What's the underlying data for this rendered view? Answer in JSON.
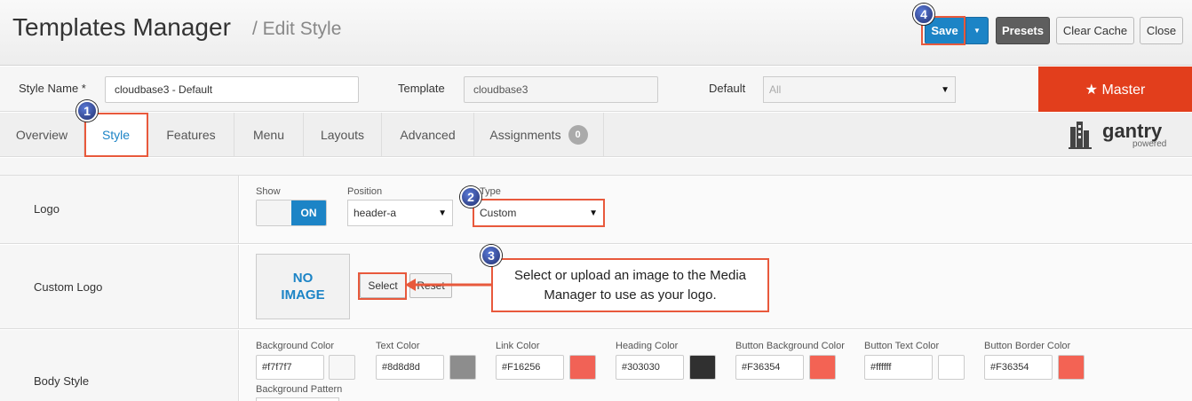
{
  "header": {
    "title": "Templates Manager",
    "subtitle": "/ Edit Style",
    "save": "Save",
    "presets": "Presets",
    "clear_cache": "Clear Cache",
    "close": "Close"
  },
  "style_row": {
    "style_name_label": "Style Name *",
    "style_name_value": "cloudbase3 - Default",
    "template_label": "Template",
    "template_value": "cloudbase3",
    "default_label": "Default",
    "default_value": "All",
    "master": "★ Master"
  },
  "tabs": [
    {
      "label": "Overview"
    },
    {
      "label": "Style"
    },
    {
      "label": "Features"
    },
    {
      "label": "Menu"
    },
    {
      "label": "Layouts"
    },
    {
      "label": "Advanced"
    },
    {
      "label": "Assignments",
      "badge": "0"
    }
  ],
  "logo": {
    "label": "Logo",
    "show_label": "Show",
    "toggle_on": "ON",
    "position_label": "Position",
    "position_value": "header-a",
    "type_label": "Type",
    "type_value": "Custom"
  },
  "custom_logo": {
    "label": "Custom Logo",
    "no_image_line1": "NO",
    "no_image_line2": "IMAGE",
    "select": "Select",
    "reset": "Reset"
  },
  "body_style": {
    "label": "Body Style",
    "fields": [
      {
        "label": "Background Color",
        "value": "#f7f7f7",
        "color": "#f7f7f7"
      },
      {
        "label": "Text Color",
        "value": "#8d8d8d",
        "color": "#8d8d8d"
      },
      {
        "label": "Link Color",
        "value": "#F16256",
        "color": "#F16256"
      },
      {
        "label": "Heading Color",
        "value": "#303030",
        "color": "#303030"
      },
      {
        "label": "Button Background Color",
        "value": "#F36354",
        "color": "#F36354"
      },
      {
        "label": "Button Text Color",
        "value": "#ffffff",
        "color": "#ffffff"
      },
      {
        "label": "Button Border Color",
        "value": "#F36354",
        "color": "#F36354"
      }
    ],
    "bg_pattern_label": "Background Pattern"
  },
  "annotations": {
    "callout_line1": "Select or upload an image to the Media",
    "callout_line2": "Manager to use as your logo.",
    "markers": [
      "1",
      "2",
      "3",
      "4"
    ]
  },
  "gantry": {
    "name": "gantry",
    "tag": "powered"
  },
  "colors": {
    "accent": "#1c84c6",
    "master": "#e23e1c",
    "annotation": "#e8593c"
  }
}
